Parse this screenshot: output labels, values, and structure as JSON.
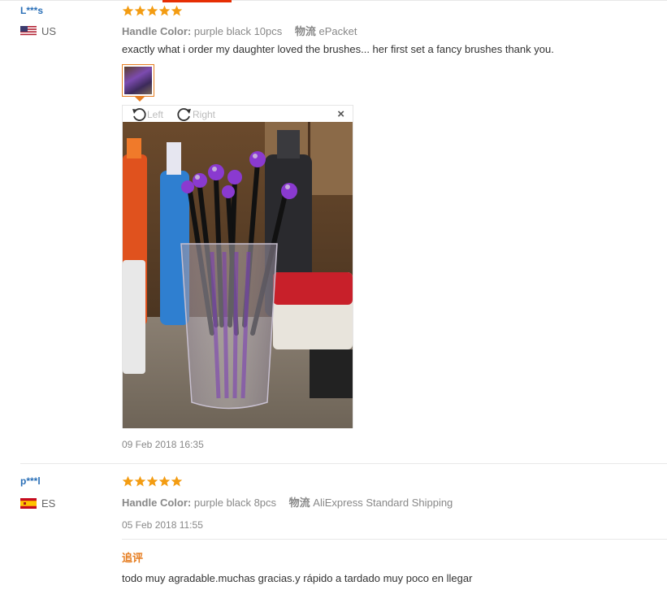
{
  "reviews": [
    {
      "user": "L***s",
      "country": "US",
      "rating": 5,
      "color_label": "Handle Color:",
      "color_value": "purple black 10pcs",
      "shipping_label": "物流",
      "shipping_value": "ePacket",
      "text": "exactly what i order my daughter loved the brushes... her first set a fancy brushes thank you.",
      "date": "09 Feb 2018 16:35",
      "viewer": {
        "rotate_left": "Left",
        "rotate_right": "Right",
        "close": "×"
      }
    },
    {
      "user": "p***l",
      "country": "ES",
      "rating": 5,
      "color_label": "Handle Color:",
      "color_value": "purple black 8pcs",
      "shipping_label": "物流",
      "shipping_value": "AliExpress Standard Shipping",
      "date": "05 Feb 2018 11:55",
      "append_label": "追评",
      "append_text": "todo muy agradable.muchas gracias.y rápido a tardado muy poco en llegar"
    }
  ],
  "colors": {
    "star": "#f39c12",
    "link": "#2a6fb7",
    "accent": "#e67e22",
    "divider": "#e8e8e8"
  }
}
